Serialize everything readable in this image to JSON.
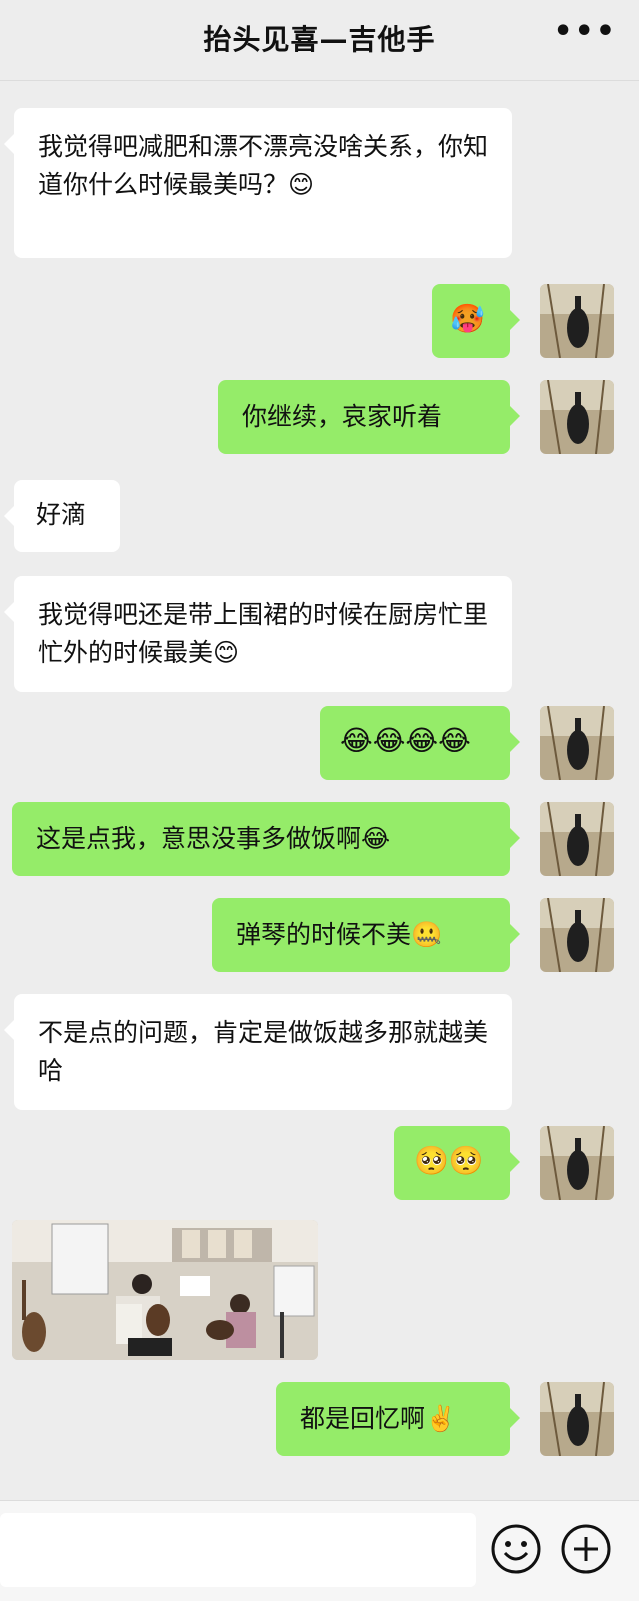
{
  "header": {
    "title": "抬头见喜—吉他手",
    "more_label": "•••"
  },
  "messages": [
    {
      "side": "left",
      "text": "我觉得吧减肥和漂不漂亮没啥关系，你知道你什么时候最美吗？😊"
    },
    {
      "side": "right",
      "text": "🥵"
    },
    {
      "side": "right",
      "text": "你继续，哀家听着"
    },
    {
      "side": "left",
      "text": "好滴"
    },
    {
      "side": "left",
      "text": "我觉得吧还是带上围裙的时候在厨房忙里忙外的时候最美😊"
    },
    {
      "side": "right",
      "text": "😂😂😂😂"
    },
    {
      "side": "right",
      "text": "这是点我，意思没事多做饭啊😂"
    },
    {
      "side": "right",
      "text": "弹琴的时候不美🤐"
    },
    {
      "side": "left",
      "text": "不是点的问题，肯定是做饭越多那就越美哈"
    },
    {
      "side": "right",
      "text": "🥺🥺"
    },
    {
      "side": "left",
      "type": "image"
    },
    {
      "side": "right",
      "text": "都是回忆啊✌️"
    }
  ],
  "footer": {
    "emoji_icon": "smiley-icon",
    "plus_icon": "plus-circle-icon"
  },
  "colors": {
    "bg": "#ededed",
    "green_bubble": "#95ec69",
    "white_bubble": "#ffffff"
  }
}
